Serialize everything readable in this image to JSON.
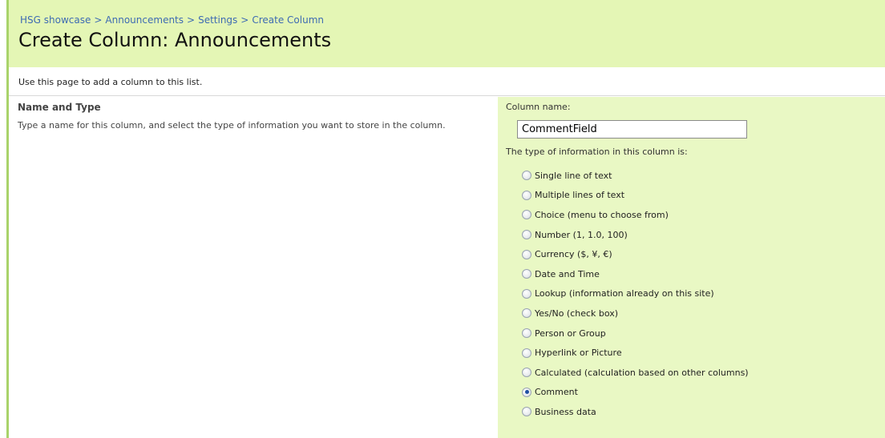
{
  "breadcrumb": {
    "items": [
      "HSG showcase",
      "Announcements",
      "Settings",
      "Create Column"
    ],
    "separator": ">"
  },
  "page": {
    "title": "Create Column: Announcements",
    "description": "Use this page to add a column to this list."
  },
  "section": {
    "title": "Name and Type",
    "description": "Type a name for this column, and select the type of information you want to store in the column."
  },
  "form": {
    "column_name_label": "Column name:",
    "column_name_value": "CommentField",
    "type_label": "The type of information in this column is:",
    "types": [
      {
        "label": "Single line of text",
        "selected": false
      },
      {
        "label": "Multiple lines of text",
        "selected": false
      },
      {
        "label": "Choice (menu to choose from)",
        "selected": false
      },
      {
        "label": "Number (1, 1.0, 100)",
        "selected": false
      },
      {
        "label": "Currency ($, ¥, €)",
        "selected": false
      },
      {
        "label": "Date and Time",
        "selected": false
      },
      {
        "label": "Lookup (information already on this site)",
        "selected": false
      },
      {
        "label": "Yes/No (check box)",
        "selected": false
      },
      {
        "label": "Person or Group",
        "selected": false
      },
      {
        "label": "Hyperlink or Picture",
        "selected": false
      },
      {
        "label": "Calculated (calculation based on other columns)",
        "selected": false
      },
      {
        "label": "Comment",
        "selected": true
      },
      {
        "label": "Business data",
        "selected": false
      }
    ]
  },
  "colors": {
    "title_band": "#e4f6b5",
    "panel": "#e9f8c4",
    "accent_bar": "#a9d36a",
    "link": "#3d6bb3"
  }
}
